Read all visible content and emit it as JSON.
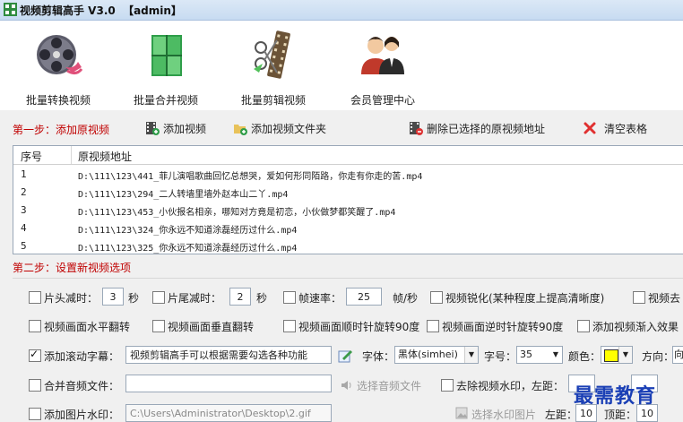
{
  "window": {
    "title": "视频剪辑高手 V3.0  【admin】"
  },
  "toolbar": {
    "items": [
      {
        "label": "批量转换视频",
        "icon": "film-reel-icon"
      },
      {
        "label": "批量合并视频",
        "icon": "building-blocks-icon"
      },
      {
        "label": "批量剪辑视频",
        "icon": "film-strip-icon"
      },
      {
        "label": "会员管理中心",
        "icon": "users-icon"
      }
    ]
  },
  "step1": {
    "label": "第一步：添加原视频",
    "add_video": "添加视频",
    "add_folder": "添加视频文件夹",
    "delete_selected": "删除已选择的原视频地址",
    "clear_table": "清空表格"
  },
  "table": {
    "columns": [
      "序号",
      "原视频地址"
    ],
    "rows": [
      {
        "n": "1",
        "path": "D:\\111\\123\\441_菲儿演唱歌曲回忆总想哭，爱如何形同陌路，你走有你走的苦.mp4"
      },
      {
        "n": "2",
        "path": "D:\\111\\123\\294_二人转墙里墙外赵本山二丫.mp4"
      },
      {
        "n": "3",
        "path": "D:\\111\\123\\453_小伙报名相亲，哪知对方竟是初恋，小伙做梦都笑醒了.mp4"
      },
      {
        "n": "4",
        "path": "D:\\111\\123\\324_你永远不知道涂磊经历过什么.mp4"
      },
      {
        "n": "5",
        "path": "D:\\111\\123\\325_你永远不知道涂磊经历过什么.mp4"
      }
    ]
  },
  "step2": {
    "label": "第二步：设置新视频选项",
    "head_cut_label": "片头减时：",
    "head_cut_value": "3",
    "unit_sec": "秒",
    "tail_cut_label": "片尾减时：",
    "tail_cut_value": "2",
    "fps_label": "帧速率：",
    "fps_value": "25",
    "fps_unit": "帧/秒",
    "sharpen_label": "视频锐化(某种程度上提高清晰度)",
    "remove_label": "视频去",
    "hflip_label": "视频画面水平翻转",
    "vflip_label": "视频画面垂直翻转",
    "rot_cw_label": "视频画面顺时针旋转90度",
    "rot_ccw_label": "视频画面逆时针旋转90度",
    "fade_label": "添加视频渐入效果",
    "scroll_sub_label": "添加滚动字幕：",
    "scroll_sub_value": "视频剪辑高手可以根据需要勾选各种功能",
    "font_label": "字体：",
    "font_value": "黑体(simhei)",
    "size_label": "字号：",
    "size_value": "35",
    "color_label": "颜色：",
    "color_value": "#ffff00",
    "direction_label": "方向：",
    "direction_value": "向",
    "merge_audio_label": "合并音频文件：",
    "merge_audio_value": "",
    "choose_audio": "选择音频文件",
    "remove_wm_label": "去除视频水印，左距：",
    "img_wm_label": "添加图片水印：",
    "img_wm_value": "C:\\Users\\Administrator\\Desktop\\2.gif",
    "choose_wm_img": "选择水印图片",
    "left_label": "左距：",
    "left_value": "10",
    "top_label": "顶距：",
    "top_value": "10"
  },
  "overlay": {
    "watermark": "最需教育"
  }
}
